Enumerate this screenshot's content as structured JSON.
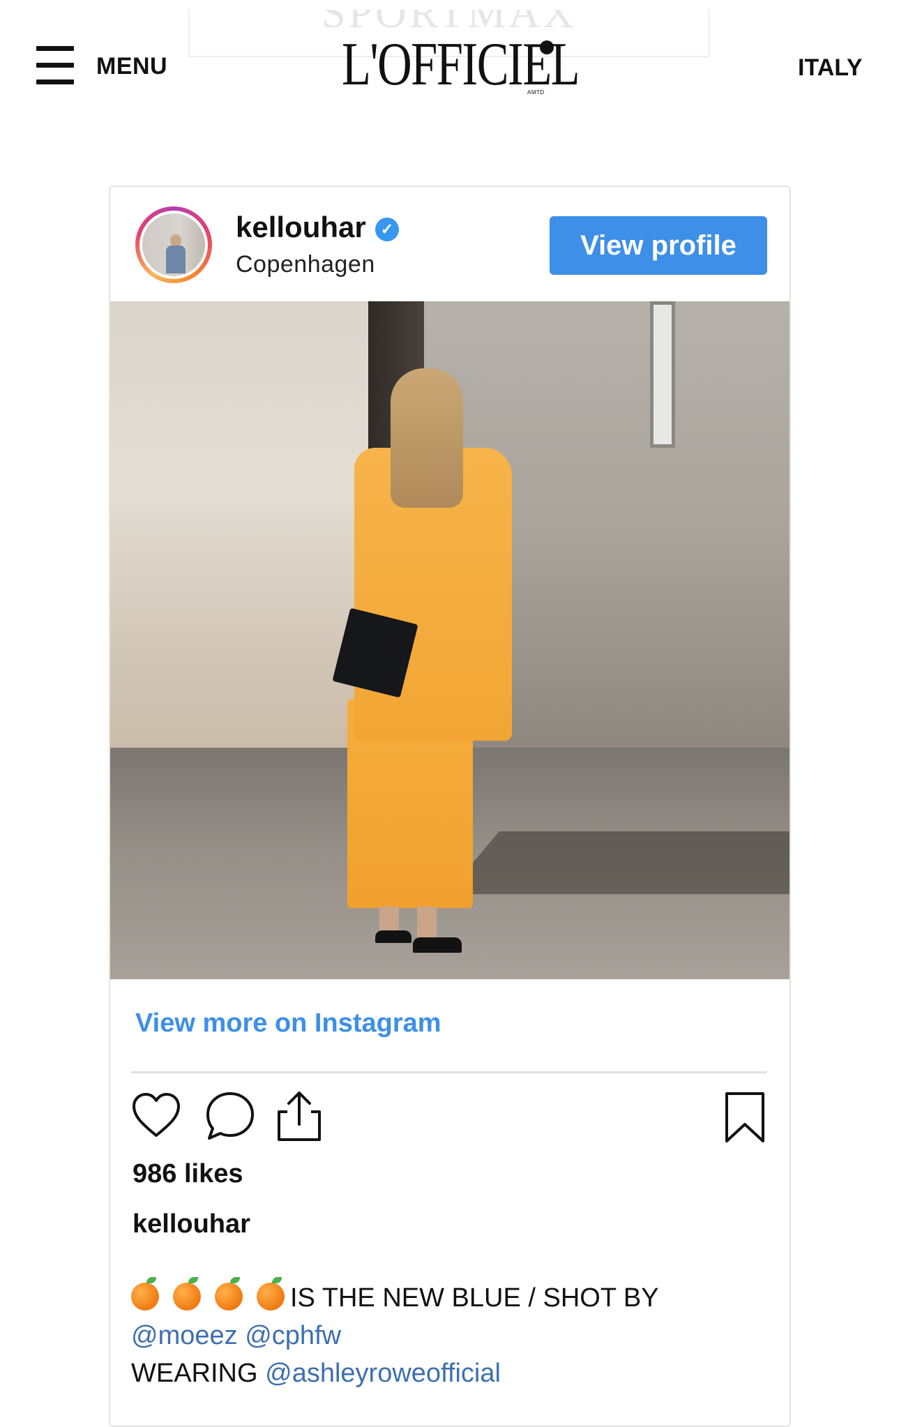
{
  "header": {
    "ad_text": "SPORTMAX",
    "menu_label": "MENU",
    "logo_text": "L'OFFICIEL",
    "logo_sub": "AMTD",
    "region": "ITALY"
  },
  "embed": {
    "username": "kellouhar",
    "verified_mark": "✓",
    "location": "Copenhagen",
    "view_profile_label": "View profile",
    "view_more_label": "View more on Instagram",
    "likes": "986 likes",
    "caption_user": "kellouhar",
    "caption_text": "IS THE NEW BLUE / SHOT BY",
    "caption_mentions_line": [
      "@moeez",
      "@cphfw"
    ],
    "caption_wearing": "WEARING",
    "caption_wearing_mention": "@ashleyroweofficial",
    "emoji": "orange-emoji",
    "emoji_count": 4
  },
  "icons": {
    "menu": "hamburger-icon",
    "like": "heart-icon",
    "comment": "comment-icon",
    "share": "share-icon",
    "save": "bookmark-icon",
    "verified": "verified-badge-icon"
  },
  "colors": {
    "accent_blue": "#3d8fe8",
    "mention_blue": "#3d6fb0",
    "text": "#111111",
    "outfit_orange": "#f2a533"
  }
}
